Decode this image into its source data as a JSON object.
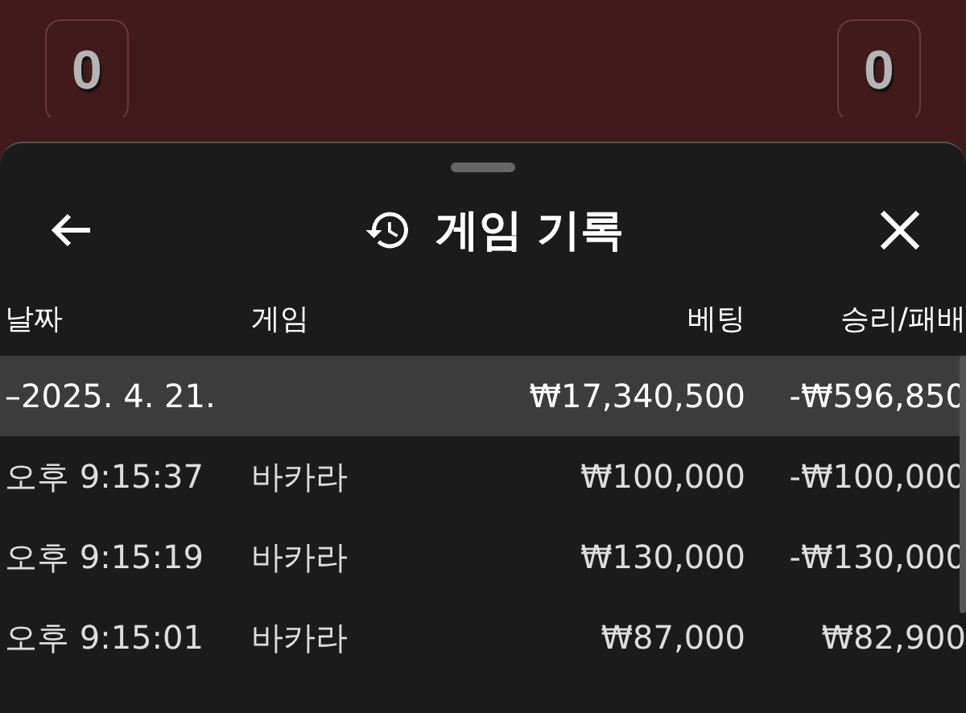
{
  "scores": [
    "0",
    "0"
  ],
  "sheet": {
    "title": "게임 기록"
  },
  "table": {
    "columns": [
      "날짜",
      "게임",
      "베팅",
      "승리/패배"
    ],
    "group": {
      "date": "–2025. 4. 21.",
      "bet": "₩17,340,500",
      "result": "-₩596,850"
    },
    "rows": [
      {
        "time": "오후 9:15:37",
        "game": "바카라",
        "bet": "₩100,000",
        "result": "-₩100,000"
      },
      {
        "time": "오후 9:15:19",
        "game": "바카라",
        "bet": "₩130,000",
        "result": "-₩130,000"
      },
      {
        "time": "오후 9:15:01",
        "game": "바카라",
        "bet": "₩87,000",
        "result": "₩82,900"
      }
    ]
  }
}
